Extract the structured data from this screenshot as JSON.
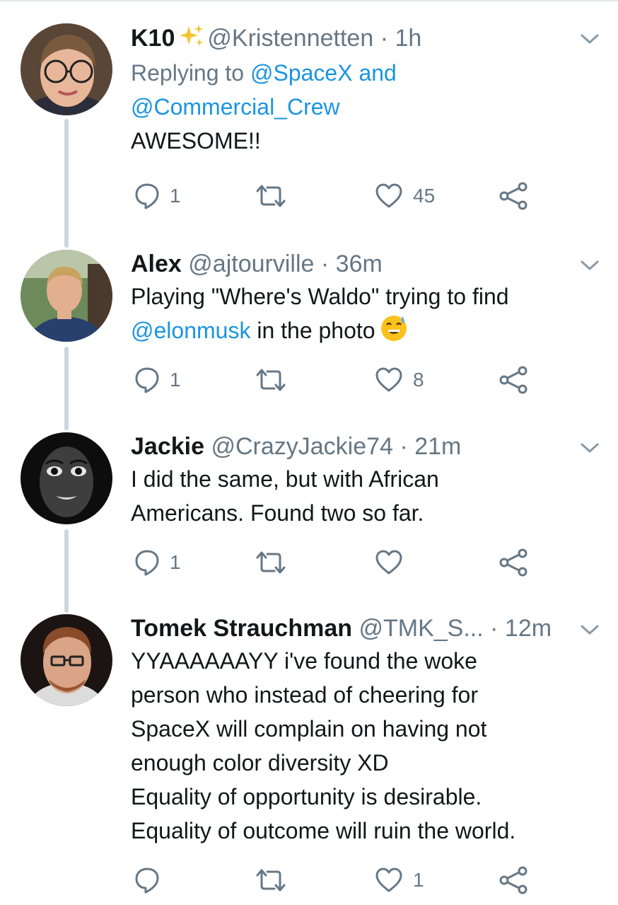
{
  "tweets": [
    {
      "name": "K10",
      "handle": "@Kristennetten",
      "separator": "·",
      "time": "1h",
      "replying_prefix": "Replying to",
      "replying_to_1": "@SpaceX",
      "replying_and": "and",
      "replying_to_2": "@Commercial_Crew",
      "text": "AWESOME!!",
      "reply_count": "1",
      "retweet_count": "",
      "like_count": "45",
      "icons": [
        "sparkles-emoji",
        "chevron-down-icon",
        "reply-icon",
        "retweet-icon",
        "heart-icon",
        "share-icon"
      ]
    },
    {
      "name": "Alex",
      "handle": "@ajtourville",
      "separator": "·",
      "time": "36m",
      "text_part1": "Playing \"Where's Waldo\" trying to find",
      "mention": "@elonmusk",
      "text_part2": "in the photo",
      "emoji": "grinning-face-with-sweat-emoji",
      "reply_count": "1",
      "retweet_count": "",
      "like_count": "8"
    },
    {
      "name": "Jackie",
      "handle": "@CrazyJackie74",
      "separator": "·",
      "time": "21m",
      "text_line1": "I did the same, but with African",
      "text_line2": "Americans. Found two so far.",
      "reply_count": "1",
      "retweet_count": "",
      "like_count": ""
    },
    {
      "name": "Tomek Strauchman",
      "handle": "@TMK_S...",
      "separator": "·",
      "time": "12m",
      "lines": [
        "YYAAAAAAYY i've found the woke",
        "person who instead of cheering for",
        "SpaceX will complain on having not",
        "enough color diversity XD",
        "Equality of opportunity is desirable.",
        "Equality of outcome will ruin the world."
      ],
      "reply_count": "",
      "retweet_count": "",
      "like_count": "1"
    }
  ],
  "colors": {
    "text": "#14171a",
    "secondary": "#657786",
    "link": "#1b95e0",
    "thread_line": "#ccd6dd"
  }
}
